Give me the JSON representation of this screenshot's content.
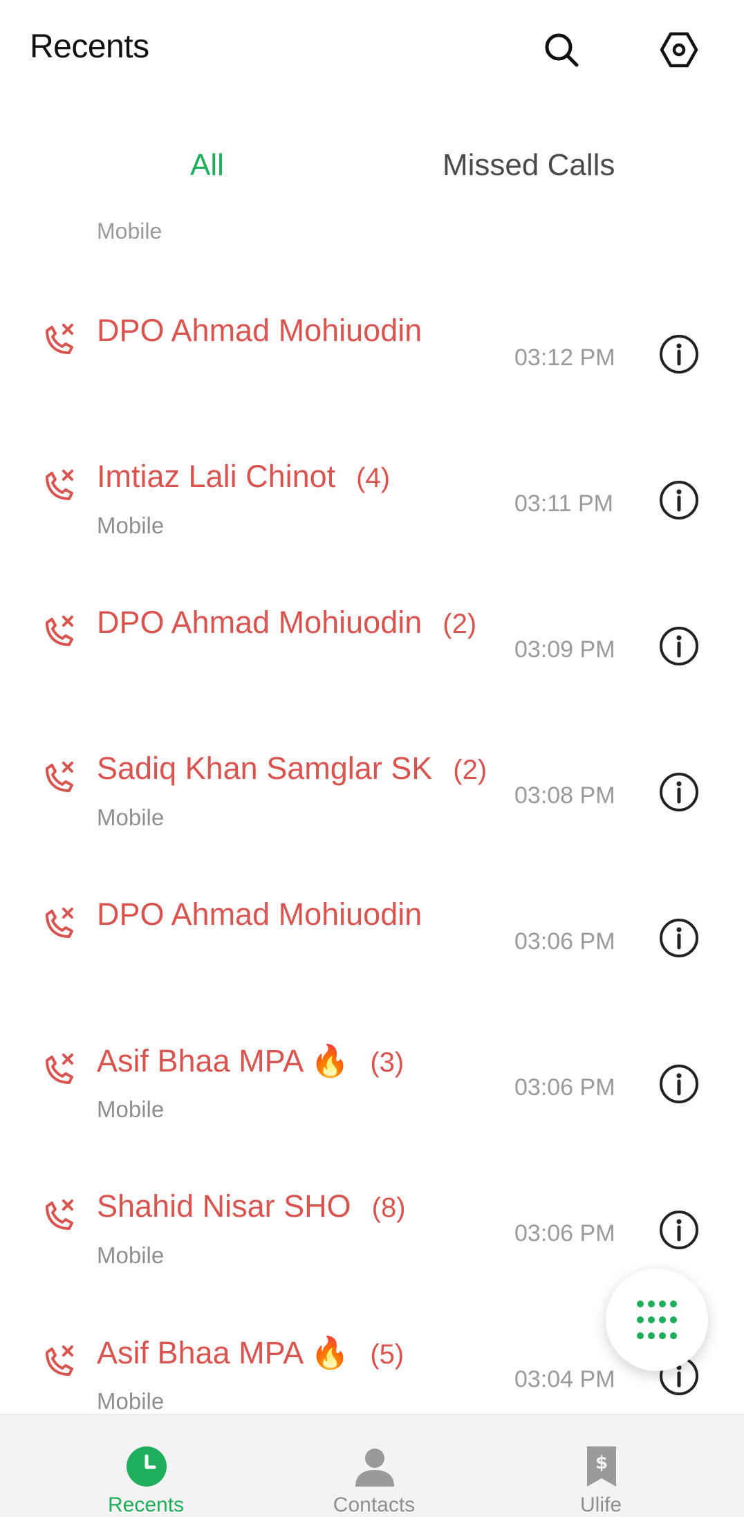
{
  "header": {
    "title": "Recents",
    "icons": [
      "search-icon",
      "settings-icon"
    ]
  },
  "tabs": [
    {
      "label": "All",
      "active": true
    },
    {
      "label": "Missed Calls",
      "active": false
    }
  ],
  "partial_row": {
    "sub": "Mobile"
  },
  "calls": [
    {
      "name": "DPO Ahmad Mohiuodin",
      "count": "",
      "sub": "",
      "time": "03:12 PM"
    },
    {
      "name": "Imtiaz Lali Chinot",
      "count": "(4)",
      "sub": "Mobile",
      "time": "03:11 PM"
    },
    {
      "name": "DPO Ahmad Mohiuodin",
      "count": "(2)",
      "sub": "",
      "time": "03:09 PM"
    },
    {
      "name": "Sadiq Khan Samglar SK",
      "count": "(2)",
      "sub": "Mobile",
      "time": "03:08 PM"
    },
    {
      "name": "DPO Ahmad Mohiuodin",
      "count": "",
      "sub": "",
      "time": "03:06 PM"
    },
    {
      "name": "Asif Bhaa MPA 🔥",
      "count": "(3)",
      "sub": "Mobile",
      "time": "03:06 PM"
    },
    {
      "name": "Shahid Nisar SHO",
      "count": "(8)",
      "sub": "Mobile",
      "time": "03:06 PM"
    },
    {
      "name": "Asif Bhaa MPA 🔥",
      "count": "(5)",
      "sub": "Mobile",
      "time": "03:04 PM"
    }
  ],
  "bottom_nav": [
    {
      "label": "Recents",
      "icon": "clock-icon",
      "active": true
    },
    {
      "label": "Contacts",
      "icon": "person-icon",
      "active": false
    },
    {
      "label": "Ulife",
      "icon": "wallet-icon",
      "active": false
    }
  ],
  "colors": {
    "accent": "#1fae5b",
    "missed": "#d9534f",
    "secondary": "#8f8f8f"
  }
}
